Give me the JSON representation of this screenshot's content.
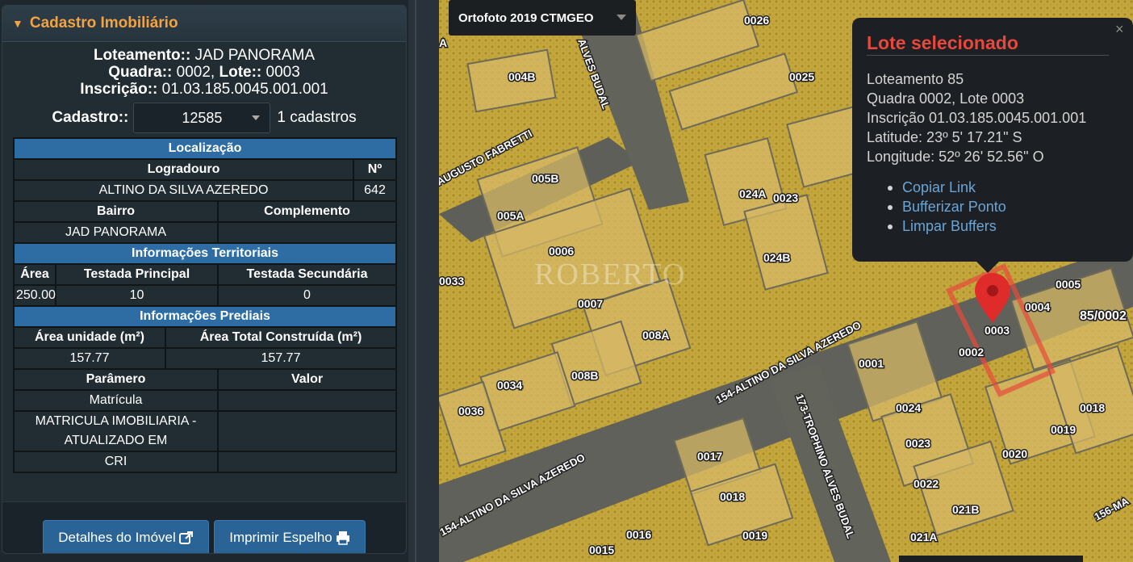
{
  "panel": {
    "title": "Cadastro Imobiliário",
    "loteamento_label": "Loteamento::",
    "loteamento_value": "JAD PANORAMA",
    "quadra_label": "Quadra::",
    "quadra_value": "0002,",
    "lote_label": "Lote::",
    "lote_value": "0003",
    "inscricao_label": "Inscrição::",
    "inscricao_value": "01.03.185.0045.001.001",
    "cadastro_label": "Cadastro::",
    "cadastro_value": "12585",
    "cadastro_count": "1 cadastros"
  },
  "localizacao": {
    "header": "Localização",
    "logradouro_label": "Logradouro",
    "numero_label": "Nº",
    "logradouro_value": "ALTINO DA SILVA AZEREDO",
    "numero_value": "642",
    "bairro_label": "Bairro",
    "complemento_label": "Complemento",
    "bairro_value": "JAD PANORAMA",
    "complemento_value": ""
  },
  "territoriais": {
    "header": "Informações Territoriais",
    "area_label": "Área",
    "testada_principal_label": "Testada Principal",
    "testada_secundaria_label": "Testada Secundária",
    "area_value": "250.00",
    "testada_principal_value": "10",
    "testada_secundaria_value": "0"
  },
  "prediais": {
    "header": "Informações Prediais",
    "area_unidade_label": "Área unidade (m²)",
    "area_total_label": "Área Total Construída (m²)",
    "area_unidade_value": "157.77",
    "area_total_value": "157.77"
  },
  "parametros": {
    "parametro_label": "Parâmero",
    "valor_label": "Valor",
    "rows": [
      {
        "name": "Matrícula",
        "value": ""
      },
      {
        "name": "MATRICULA IMOBILIARIA - ATUALIZADO EM",
        "value": ""
      },
      {
        "name": "CRI",
        "value": ""
      }
    ]
  },
  "footer": {
    "details_button": "Detalhes do Imóvel",
    "print_button": "Imprimir Espelho"
  },
  "map": {
    "basemap_label": "Ortofoto 2019 CTMGEO",
    "watermark": "ROBERTO",
    "streets": [
      "ALVES BUDAL",
      "AUGUSTO FABRETTI",
      "154-ALTINO DA SILVA AZEREDO",
      "173-TROPHINO ALVES BUDAL",
      "154-ALTINO DA SILVA AZEREDO",
      "156-MA"
    ],
    "lots": [
      "0003",
      "004B",
      "0026",
      "0025",
      "005B",
      "005A",
      "0006",
      "024A",
      "0023",
      "024B",
      "0033",
      "0007",
      "008A",
      "008B",
      "0034",
      "0036",
      "0017",
      "0018",
      "0019",
      "0016",
      "0015",
      "0024",
      "0023",
      "0022",
      "021B",
      "021A",
      "0020",
      "0019",
      "0018",
      "0001",
      "0002",
      "0003",
      "0004",
      "0005",
      "85/0002",
      "A"
    ],
    "accent_color": "#e8483b",
    "popup": {
      "title": "Lote selecionado",
      "close": "×",
      "lines": [
        "Loteamento 85",
        "Quadra 0002, Lote 0003",
        "Inscrição 01.03.185.0045.001.001",
        "Latitude: 23º 5' 17.21\" S",
        "Longitude: 52º 26' 52.56\" O"
      ],
      "links": [
        "Copiar Link",
        "Bufferizar Ponto",
        "Limpar Buffers"
      ]
    }
  }
}
